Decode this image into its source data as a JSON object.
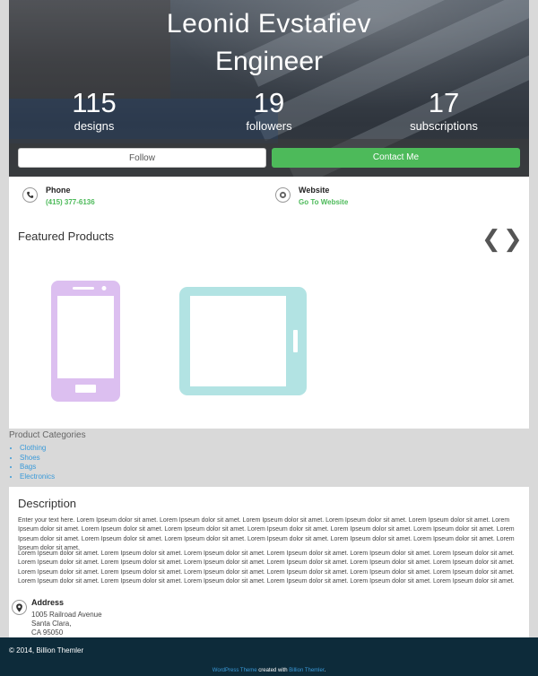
{
  "profile": {
    "name": "Leonid Evstafiev",
    "title": "Engineer",
    "stats": [
      {
        "value": "115",
        "label": "designs"
      },
      {
        "value": "19",
        "label": "followers"
      },
      {
        "value": "17",
        "label": "subscriptions"
      }
    ],
    "follow_label": "Follow",
    "contact_label": "Contact Me"
  },
  "contact": {
    "phone_title": "Phone",
    "phone_value": "(415) 377-6136",
    "website_title": "Website",
    "website_value": "Go To Website"
  },
  "featured": {
    "title": "Featured Products",
    "prev": "❮",
    "next": "❯",
    "products": [
      {
        "icon": "smartphone-icon",
        "color": "#dcbff0"
      },
      {
        "icon": "tablet-icon",
        "color": "#b2e3e3"
      }
    ]
  },
  "categories": {
    "title": "Product Categories",
    "items": [
      "Clothing",
      "Shoes",
      "Bags",
      "Electronics"
    ]
  },
  "description": {
    "title": "Description",
    "p1": "Enter your text here. Lorem Ipseum dolor sit amet. Lorem Ipseum dolor sit amet. Lorem Ipseum dolor sit amet. Lorem Ipseum dolor sit amet. Lorem Ipseum dolor sit amet. Lorem Ipseum dolor sit amet. Lorem Ipseum dolor sit amet. Lorem Ipseum dolor sit amet. Lorem Ipseum dolor sit amet. Lorem Ipseum dolor sit amet. Lorem Ipseum dolor sit amet. Lorem Ipseum dolor sit amet. Lorem Ipseum dolor sit amet. Lorem Ipseum dolor sit amet. Lorem Ipseum dolor sit amet. Lorem Ipseum dolor sit amet. Lorem Ipseum dolor sit amet. Lorem Ipseum dolor sit amet.",
    "p2": "Lorem Ipseum dolor sit amet. Lorem Ipseum dolor sit amet. Lorem Ipseum dolor sit amet. Lorem Ipseum dolor sit amet. Lorem Ipseum dolor sit amet. Lorem Ipseum dolor sit amet. Lorem Ipseum dolor sit amet. Lorem Ipseum dolor sit amet. Lorem Ipseum dolor sit amet. Lorem Ipseum dolor sit amet. Lorem Ipseum dolor sit amet. Lorem Ipseum dolor sit amet. Lorem Ipseum dolor sit amet. Lorem Ipseum dolor sit amet. Lorem Ipseum dolor sit amet. Lorem Ipseum dolor sit amet. Lorem Ipseum dolor sit amet. Lorem Ipseum dolor sit amet. Lorem Ipseum dolor sit amet. Lorem Ipseum dolor sit amet. Lorem Ipseum dolor sit amet. Lorem Ipseum dolor sit amet. Lorem Ipseum dolor sit amet. Lorem Ipseum dolor sit amet."
  },
  "address": {
    "title": "Address",
    "line1": "1005 Railroad Avenue",
    "line2": "Santa Clara,",
    "line3": "CA 95050"
  },
  "footer": {
    "copyright": "© 2014, Billion Themler",
    "credit_link1": "WordPress Theme",
    "credit_mid": " created with ",
    "credit_link2": "Billion Themler",
    "credit_end": "."
  },
  "colors": {
    "accent_green": "#4dba5a",
    "link_blue": "#3a9ad9",
    "footer_bg": "#0d2b3a"
  }
}
